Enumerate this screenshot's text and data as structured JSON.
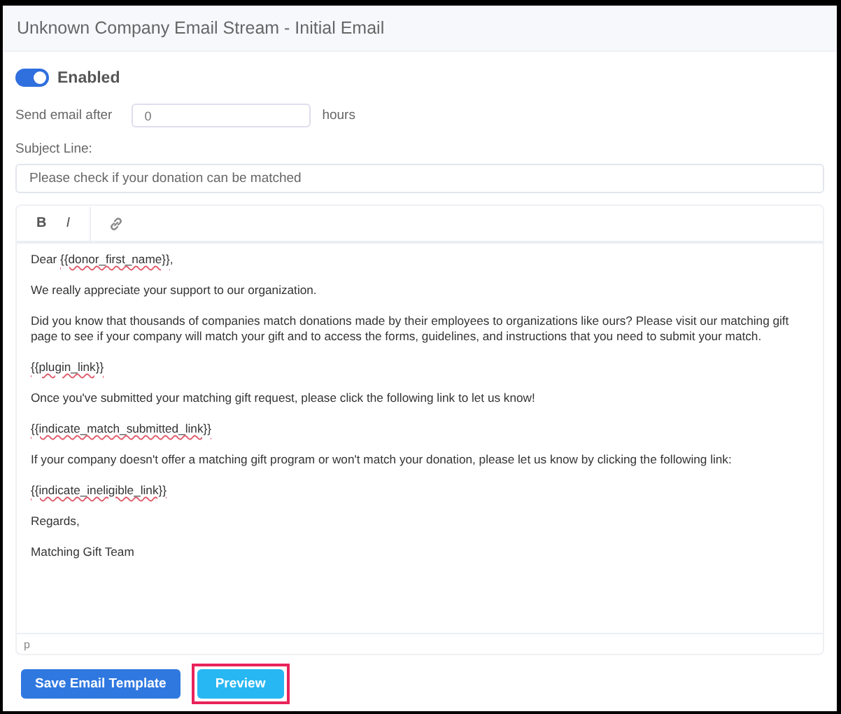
{
  "window": {
    "title": "Unknown Company Email Stream - Initial Email"
  },
  "enabled": {
    "label": "Enabled",
    "on": true
  },
  "delay": {
    "label": "Send email after",
    "value": "0",
    "unit": "hours"
  },
  "subject": {
    "label": "Subject Line:",
    "value": "Please check if your donation can be matched"
  },
  "toolbar": [
    {
      "kind": "bold",
      "label": "B"
    },
    {
      "kind": "italic",
      "label": "I"
    },
    {
      "kind": "link"
    }
  ],
  "body": [
    [
      {
        "text": "Dear "
      },
      {
        "text": "{{donor_first_name}}",
        "flagged": true
      },
      {
        "text": ","
      }
    ],
    [
      {
        "text": "We really appreciate your support to our organization."
      }
    ],
    [
      {
        "text": "Did you know that thousands of companies match donations made by their employees to organizations like ours? Please visit our matching gift page to see if your company will match your gift and to access the forms, guidelines, and instructions that you need to submit your match."
      }
    ],
    [
      {
        "text": "{{plugin_link}}",
        "flagged": true
      }
    ],
    [
      {
        "text": "Once you've submitted your matching gift request, please click the following link to let us know!"
      }
    ],
    [
      {
        "text": "{{indicate_match_submitted_link}}",
        "flagged": true
      }
    ],
    [
      {
        "text": "If your company doesn't offer a matching gift program or won't match your donation, please let us know by clicking the following link:"
      }
    ],
    [
      {
        "text": "{{indicate_ineligible_link}}",
        "flagged": true
      }
    ],
    [
      {
        "text": "Regards,"
      }
    ],
    [
      {
        "text": "Matching Gift Team"
      }
    ]
  ],
  "status_bar": "p",
  "buttons": [
    {
      "label": "Save Email Template",
      "kind": "primary",
      "highlighted": false
    },
    {
      "label": "Preview",
      "kind": "secondary",
      "highlighted": true
    }
  ]
}
